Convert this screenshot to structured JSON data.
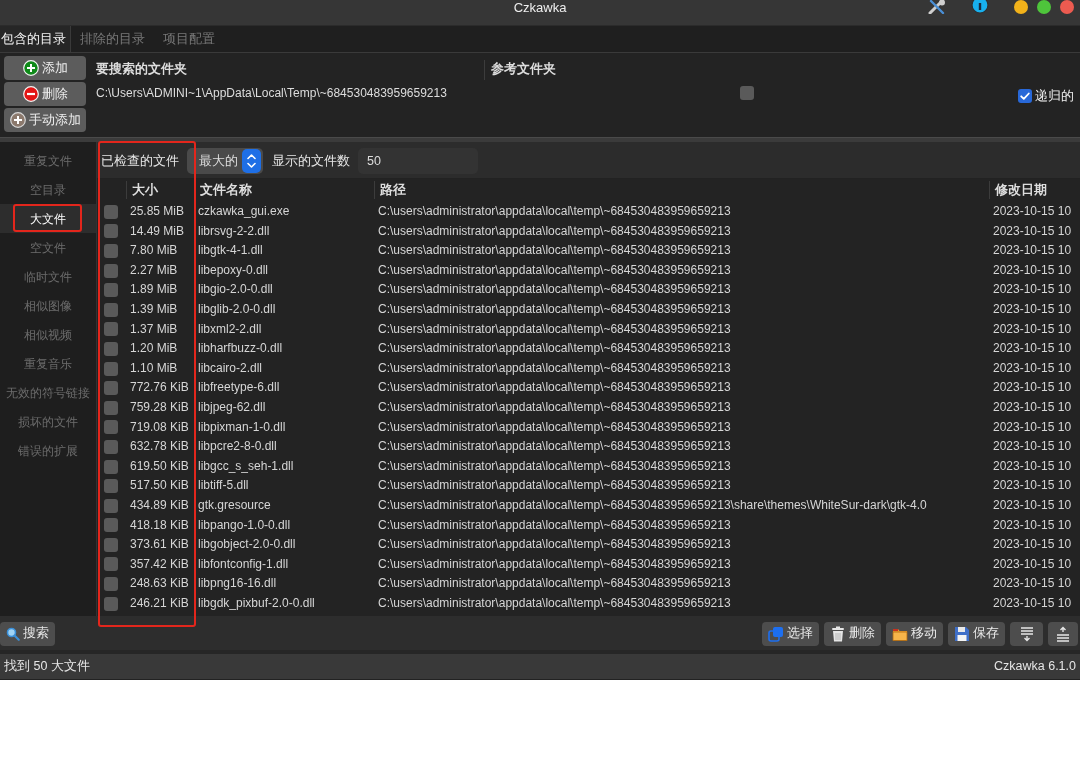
{
  "window": {
    "title": "Czkawka"
  },
  "tabs": [
    {
      "label": "包含的目录",
      "selected": true
    },
    {
      "label": "排除的目录",
      "selected": false
    },
    {
      "label": "项目配置",
      "selected": false
    }
  ],
  "directory_buttons": [
    {
      "kind": "add",
      "label": "添加"
    },
    {
      "kind": "remove",
      "label": "删除"
    },
    {
      "kind": "manual-add",
      "label": "手动添加"
    }
  ],
  "directories": {
    "columns": [
      "要搜索的文件夹",
      "参考文件夹"
    ],
    "rows": [
      {
        "path": "C:\\Users\\ADMINI~1\\AppData\\Local\\Temp\\~684530483959659213",
        "reference": false
      }
    ]
  },
  "recursive": {
    "label": "递归的",
    "checked": true
  },
  "sidebar": {
    "items": [
      {
        "label": "重复文件",
        "selected": false,
        "circled": false
      },
      {
        "label": "空目录",
        "selected": false,
        "circled": false
      },
      {
        "label": "大文件",
        "selected": true,
        "circled": true
      },
      {
        "label": "空文件",
        "selected": false,
        "circled": false
      },
      {
        "label": "临时文件",
        "selected": false,
        "circled": false
      },
      {
        "label": "相似图像",
        "selected": false,
        "circled": false
      },
      {
        "label": "相似视频",
        "selected": false,
        "circled": false
      },
      {
        "label": "重复音乐",
        "selected": false,
        "circled": false
      },
      {
        "label": "无效的符号链接",
        "selected": false,
        "circled": false
      },
      {
        "label": "损坏的文件",
        "selected": false,
        "circled": false
      },
      {
        "label": "错误的扩展",
        "selected": false,
        "circled": false
      }
    ]
  },
  "toolbar": {
    "checked_label": "已检查的文件",
    "mode": {
      "value": "最大的"
    },
    "count_label": "显示的文件数",
    "count": {
      "value": "50"
    }
  },
  "results": {
    "columns": [
      {
        "kind": "check",
        "circled": true
      },
      {
        "kind": "text",
        "label": "大小",
        "circled": true
      },
      {
        "kind": "text",
        "label": "文件名称",
        "circled": false
      },
      {
        "kind": "text",
        "label": "路径",
        "circled": false
      },
      {
        "kind": "text",
        "label": "修改日期",
        "circled": false
      }
    ],
    "rows": [
      {
        "checked": false,
        "size": "25.85 MiB",
        "name": "czkawka_gui.exe",
        "path": "C:\\users\\administrator\\appdata\\local\\temp\\~684530483959659213",
        "date": "2023-10-15 10"
      },
      {
        "checked": false,
        "size": "14.49 MiB",
        "name": "librsvg-2-2.dll",
        "path": "C:\\users\\administrator\\appdata\\local\\temp\\~684530483959659213",
        "date": "2023-10-15 10"
      },
      {
        "checked": false,
        "size": "7.80 MiB",
        "name": "libgtk-4-1.dll",
        "path": "C:\\users\\administrator\\appdata\\local\\temp\\~684530483959659213",
        "date": "2023-10-15 10"
      },
      {
        "checked": false,
        "size": "2.27 MiB",
        "name": "libepoxy-0.dll",
        "path": "C:\\users\\administrator\\appdata\\local\\temp\\~684530483959659213",
        "date": "2023-10-15 10"
      },
      {
        "checked": false,
        "size": "1.89 MiB",
        "name": "libgio-2.0-0.dll",
        "path": "C:\\users\\administrator\\appdata\\local\\temp\\~684530483959659213",
        "date": "2023-10-15 10"
      },
      {
        "checked": false,
        "size": "1.39 MiB",
        "name": "libglib-2.0-0.dll",
        "path": "C:\\users\\administrator\\appdata\\local\\temp\\~684530483959659213",
        "date": "2023-10-15 10"
      },
      {
        "checked": false,
        "size": "1.37 MiB",
        "name": "libxml2-2.dll",
        "path": "C:\\users\\administrator\\appdata\\local\\temp\\~684530483959659213",
        "date": "2023-10-15 10"
      },
      {
        "checked": false,
        "size": "1.20 MiB",
        "name": "libharfbuzz-0.dll",
        "path": "C:\\users\\administrator\\appdata\\local\\temp\\~684530483959659213",
        "date": "2023-10-15 10"
      },
      {
        "checked": false,
        "size": "1.10 MiB",
        "name": "libcairo-2.dll",
        "path": "C:\\users\\administrator\\appdata\\local\\temp\\~684530483959659213",
        "date": "2023-10-15 10"
      },
      {
        "checked": false,
        "size": "772.76 KiB",
        "name": "libfreetype-6.dll",
        "path": "C:\\users\\administrator\\appdata\\local\\temp\\~684530483959659213",
        "date": "2023-10-15 10"
      },
      {
        "checked": false,
        "size": "759.28 KiB",
        "name": "libjpeg-62.dll",
        "path": "C:\\users\\administrator\\appdata\\local\\temp\\~684530483959659213",
        "date": "2023-10-15 10"
      },
      {
        "checked": false,
        "size": "719.08 KiB",
        "name": "libpixman-1-0.dll",
        "path": "C:\\users\\administrator\\appdata\\local\\temp\\~684530483959659213",
        "date": "2023-10-15 10"
      },
      {
        "checked": false,
        "size": "632.78 KiB",
        "name": "libpcre2-8-0.dll",
        "path": "C:\\users\\administrator\\appdata\\local\\temp\\~684530483959659213",
        "date": "2023-10-15 10"
      },
      {
        "checked": false,
        "size": "619.50 KiB",
        "name": "libgcc_s_seh-1.dll",
        "path": "C:\\users\\administrator\\appdata\\local\\temp\\~684530483959659213",
        "date": "2023-10-15 10"
      },
      {
        "checked": false,
        "size": "517.50 KiB",
        "name": "libtiff-5.dll",
        "path": "C:\\users\\administrator\\appdata\\local\\temp\\~684530483959659213",
        "date": "2023-10-15 10"
      },
      {
        "checked": false,
        "size": "434.89 KiB",
        "name": "gtk.gresource",
        "path": "C:\\users\\administrator\\appdata\\local\\temp\\~684530483959659213\\share\\themes\\WhiteSur-dark\\gtk-4.0",
        "date": "2023-10-15 10"
      },
      {
        "checked": false,
        "size": "418.18 KiB",
        "name": "libpango-1.0-0.dll",
        "path": "C:\\users\\administrator\\appdata\\local\\temp\\~684530483959659213",
        "date": "2023-10-15 10"
      },
      {
        "checked": false,
        "size": "373.61 KiB",
        "name": "libgobject-2.0-0.dll",
        "path": "C:\\users\\administrator\\appdata\\local\\temp\\~684530483959659213",
        "date": "2023-10-15 10"
      },
      {
        "checked": false,
        "size": "357.42 KiB",
        "name": "libfontconfig-1.dll",
        "path": "C:\\users\\administrator\\appdata\\local\\temp\\~684530483959659213",
        "date": "2023-10-15 10"
      },
      {
        "checked": false,
        "size": "248.63 KiB",
        "name": "libpng16-16.dll",
        "path": "C:\\users\\administrator\\appdata\\local\\temp\\~684530483959659213",
        "date": "2023-10-15 10"
      },
      {
        "checked": false,
        "size": "246.21 KiB",
        "name": "libgdk_pixbuf-2.0-0.dll",
        "path": "C:\\users\\administrator\\appdata\\local\\temp\\~684530483959659213",
        "date": "2023-10-15 10"
      }
    ]
  },
  "actions": {
    "search": {
      "label": "搜索"
    },
    "buttons": [
      {
        "kind": "select",
        "label": "选择"
      },
      {
        "kind": "delete",
        "label": "删除"
      },
      {
        "kind": "move",
        "label": "移动"
      },
      {
        "kind": "save",
        "label": "保存"
      },
      {
        "kind": "move-down"
      },
      {
        "kind": "move-up"
      }
    ]
  },
  "status_bar": {
    "left": "找到 50 大文件",
    "right": "Czkawka 6.1.0"
  }
}
